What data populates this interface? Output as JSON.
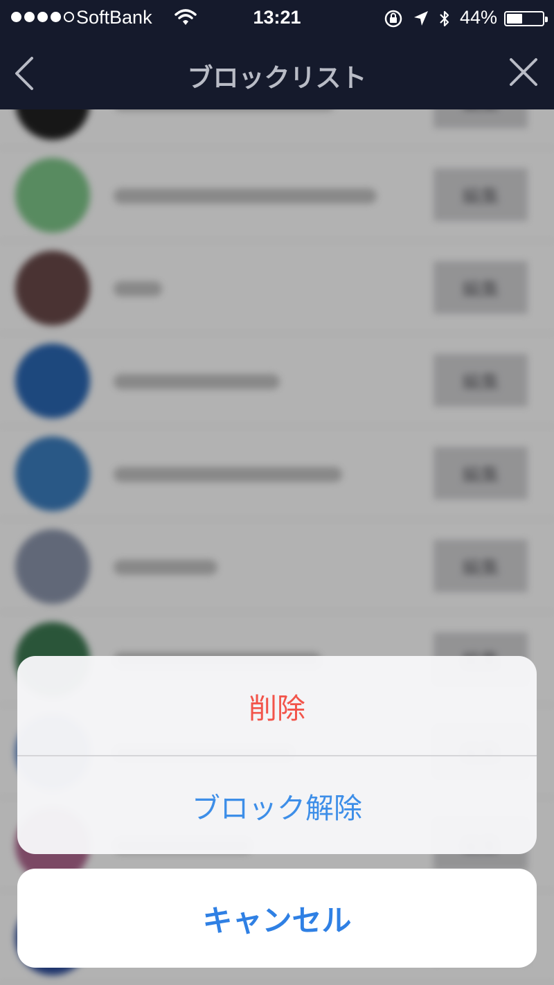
{
  "status_bar": {
    "carrier": "SoftBank",
    "time": "13:21",
    "battery_percent": "44%",
    "battery_level": 0.44,
    "signal_bars_filled": 4,
    "signal_bars_total": 5,
    "icons": [
      "wifi-icon",
      "orientation-lock-icon",
      "location-arrow-icon",
      "bluetooth-icon",
      "battery-icon"
    ]
  },
  "nav": {
    "title": "ブロックリスト",
    "back_icon": "chevron-left-icon",
    "close_icon": "close-icon"
  },
  "list": {
    "edit_label": "編集",
    "avatar_colors": [
      "#222222",
      "#7fc78a",
      "#6a4a4a",
      "#2a67b4",
      "#3c7ec0",
      "#8c96ad",
      "#3d7a52",
      "#5b86c8",
      "#b06890",
      "#2a4a9a"
    ]
  },
  "action_sheet": {
    "delete_label": "削除",
    "unblock_label": "ブロック解除",
    "cancel_label": "キャンセル"
  },
  "colors": {
    "nav_background": "#151a2c",
    "delete_red": "#f2544a",
    "action_blue": "#3d8ee8"
  }
}
